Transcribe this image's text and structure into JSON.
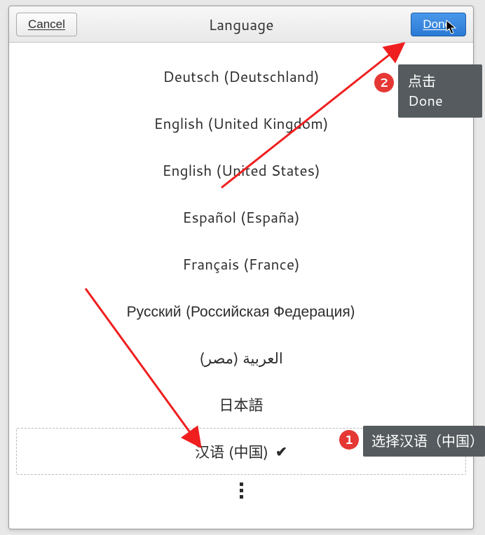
{
  "buttons": {
    "cancel": "Cancel",
    "done": "Done"
  },
  "title": "Language",
  "languages": [
    {
      "label": "Deutsch (Deutschland)",
      "selected": false
    },
    {
      "label": "English (United Kingdom)",
      "selected": false
    },
    {
      "label": "English (United States)",
      "selected": false
    },
    {
      "label": "Español (España)",
      "selected": false
    },
    {
      "label": "Français (France)",
      "selected": false
    },
    {
      "label": "Русский (Российская Федерация)",
      "selected": false
    },
    {
      "label": "العربية (مصر)",
      "selected": false
    },
    {
      "label": "日本語",
      "selected": false
    },
    {
      "label": "汉语 (中国)",
      "selected": true
    }
  ],
  "annotations": {
    "step1": {
      "num": "1",
      "text": "选择汉语（中国）"
    },
    "step2": {
      "num": "2",
      "text_line1": "点击",
      "text_line2": "Done"
    }
  }
}
